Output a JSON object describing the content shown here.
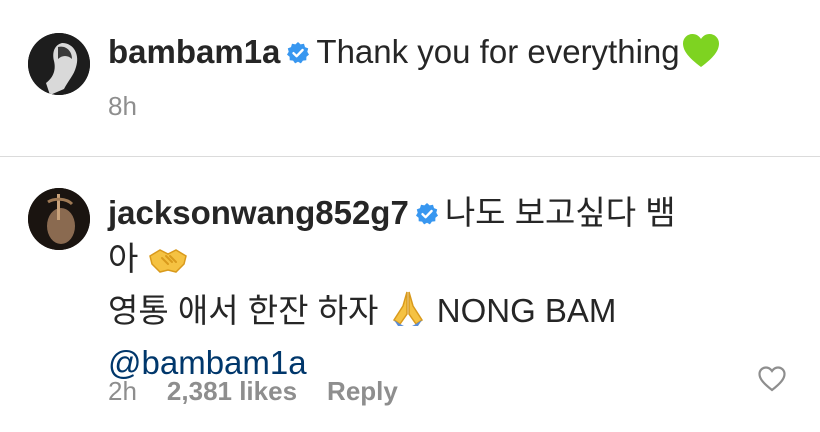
{
  "caption": {
    "username": "bambam1a",
    "text": "Thank you for everything",
    "time": "8h",
    "emoji": "green-heart-icon"
  },
  "comment": {
    "username": "jacksonwang852g7",
    "line1": "나도 보고싶다 뱀",
    "line2_prefix": "아",
    "line3_text": "영통 애서 한잔 하자",
    "line3_suffix": "NONG BAM",
    "mention": "@bambam1a",
    "time": "2h",
    "likes": "2,381 likes",
    "reply": "Reply",
    "emojis": [
      "handshake-icon",
      "folded-hands-icon"
    ]
  },
  "colors": {
    "text": "#262626",
    "muted": "#8e8e8e",
    "verified": "#3897f0",
    "mention": "#00376b",
    "heart": "#7ed321"
  }
}
